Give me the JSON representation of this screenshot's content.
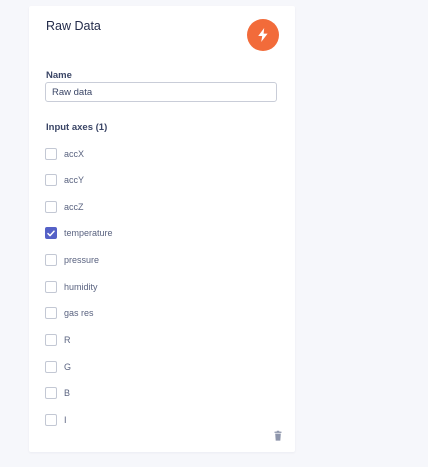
{
  "block": {
    "title": "Raw Data",
    "icon": "lightning-bolt-icon",
    "accent_color": "#f26b3a"
  },
  "name_field": {
    "label": "Name",
    "value": "Raw data"
  },
  "axes": {
    "label": "Input axes (1)",
    "items": [
      {
        "label": "accX",
        "checked": false
      },
      {
        "label": "accY",
        "checked": false
      },
      {
        "label": "accZ",
        "checked": false
      },
      {
        "label": "temperature",
        "checked": true
      },
      {
        "label": "pressure",
        "checked": false
      },
      {
        "label": "humidity",
        "checked": false
      },
      {
        "label": "gas res",
        "checked": false
      },
      {
        "label": "R",
        "checked": false
      },
      {
        "label": "G",
        "checked": false
      },
      {
        "label": "B",
        "checked": false
      },
      {
        "label": "I",
        "checked": false
      }
    ]
  },
  "actions": {
    "delete_icon": "trash-icon"
  }
}
